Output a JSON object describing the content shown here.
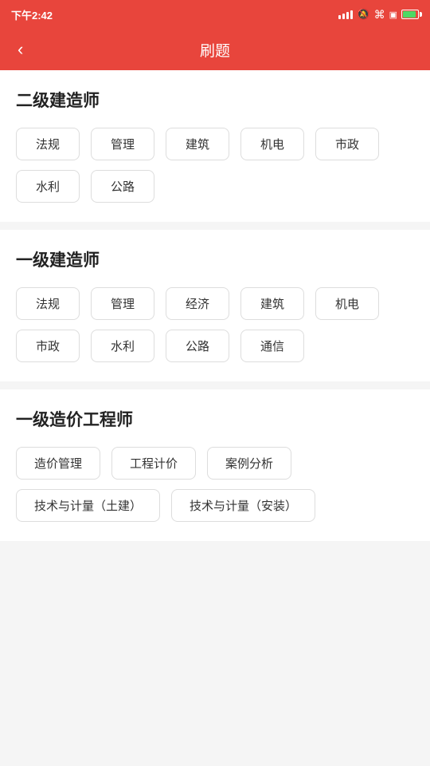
{
  "statusBar": {
    "time": "下午2:42",
    "batteryColor": "#4cd964"
  },
  "header": {
    "title": "刷题",
    "backLabel": "‹"
  },
  "sections": [
    {
      "id": "level2",
      "title": "二级建造师",
      "tags": [
        {
          "label": "法规"
        },
        {
          "label": "管理"
        },
        {
          "label": "建筑"
        },
        {
          "label": "机电"
        },
        {
          "label": "市政"
        },
        {
          "label": "水利"
        },
        {
          "label": "公路"
        }
      ]
    },
    {
      "id": "level1",
      "title": "一级建造师",
      "tags": [
        {
          "label": "法规"
        },
        {
          "label": "管理"
        },
        {
          "label": "经济"
        },
        {
          "label": "建筑"
        },
        {
          "label": "机电"
        },
        {
          "label": "市政"
        },
        {
          "label": "水利"
        },
        {
          "label": "公路"
        },
        {
          "label": "通信"
        }
      ]
    },
    {
      "id": "cost-engineer",
      "title": "一级造价工程师",
      "tags": [
        {
          "label": "造价管理"
        },
        {
          "label": "工程计价"
        },
        {
          "label": "案例分析"
        },
        {
          "label": "技术与计量（土建）"
        },
        {
          "label": "技术与计量（安装）"
        }
      ]
    }
  ]
}
